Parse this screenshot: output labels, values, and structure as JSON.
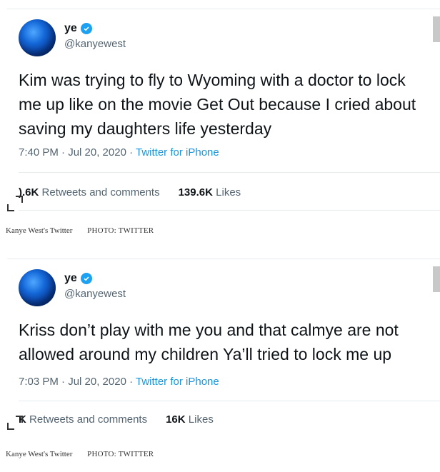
{
  "tweets": [
    {
      "display_name": "ye",
      "handle": "@kanyewest",
      "text_lines": [
        "Kim was trying to fly to Wyoming with a doctor to lock",
        "me up like on the movie Get Out because I cried about",
        "saving my daughters life yesterday"
      ],
      "time": "7:40 PM · Jul 20, 2020 ·",
      "source": "Twitter for iPhone",
      "retweets_count": ").6K",
      "retweets_label": "Retweets and comments",
      "likes_count": "139.6K",
      "likes_label": "Likes"
    },
    {
      "display_name": "ye",
      "handle": "@kanyewest",
      "text_lines": [
        "Kriss don’t play with me  you and that calmye are not",
        "allowed around my children   Ya’ll tried to lock me up"
      ],
      "time": "7:03 PM · Jul 20, 2020 ·",
      "source": "Twitter for iPhone",
      "retweets_count": "K",
      "retweets_label": "Retweets and comments",
      "likes_count": "16K",
      "likes_label": "Likes"
    }
  ],
  "captions": [
    {
      "text": "Kanye West's Twitter",
      "credit": "PHOTO: TWITTER"
    },
    {
      "text": "Kanye West's Twitter",
      "credit": "PHOTO: TWITTER"
    }
  ],
  "colors": {
    "verified": "#1da1f2",
    "link": "#1b95e0",
    "secondary": "#536471"
  }
}
